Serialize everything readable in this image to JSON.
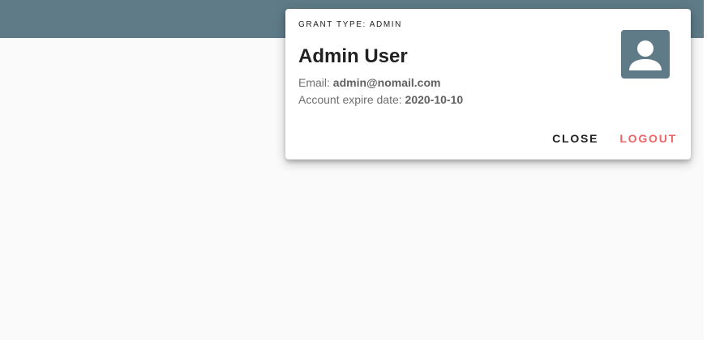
{
  "user_card": {
    "grant_type_label": "GRANT TYPE: ADMIN",
    "name": "Admin User",
    "email_label": "Email:",
    "email_value": "admin@nomail.com",
    "expire_label": "Account expire date:",
    "expire_value": "2020-10-10",
    "avatar_icon": "account-box-icon",
    "actions": {
      "close_label": "CLOSE",
      "logout_label": "LOGOUT"
    }
  },
  "colors": {
    "toolbar": "#5f7b88",
    "avatar_bg": "#5f7b88",
    "logout": "#ef6467",
    "page_bg": "#fafafa"
  }
}
